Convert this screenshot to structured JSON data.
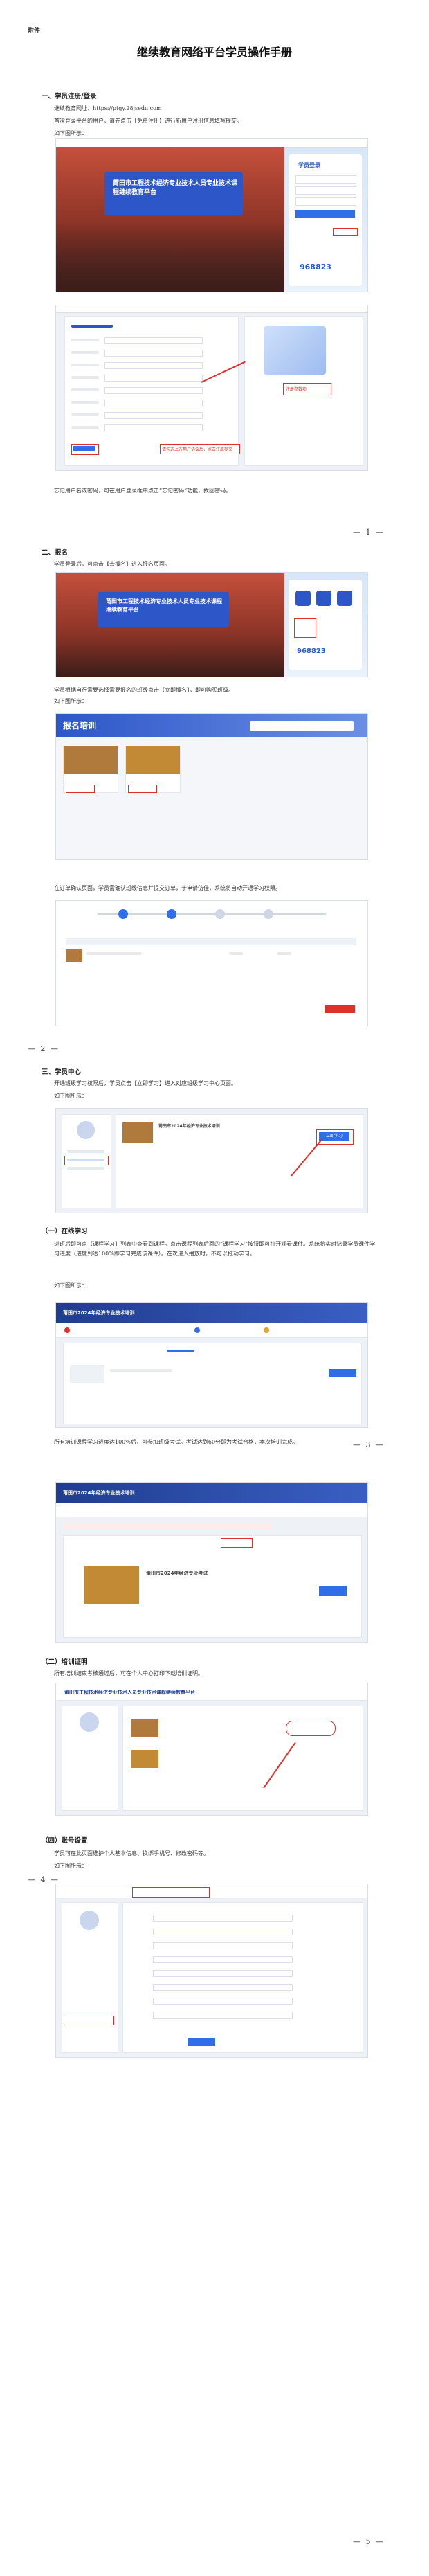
{
  "attachment": "附件",
  "title": "继续教育网络平台学员操作手册",
  "s1": {
    "heading": "一、学员注册/登录",
    "site": "继续教育网址：https://ptgy.28jsedu.com",
    "reg_text": "首次登录平台的用户，请先点击【免费注册】进行新用户注册信息填写提交。",
    "fig": "如下图所示：",
    "forgot": "忘记用户名或密码，可在用户登录框中点击“忘记密码”功能，找回密码。",
    "banner_title": "莆田市工程技术经济专业技术人员专业技术课程继续教育平台",
    "login_title": "学员登录",
    "phone": "968823",
    "reg_callout": "注册参数项",
    "agree_tip": "请勾选上方用户协议后，点击注册提交"
  },
  "page1": "— 1 —",
  "s2": {
    "heading": "二、报名",
    "text1": "学员登录后，可点击【去报名】进入报名页面。",
    "banner_title": "莆田市工程技术经济专业技术人员专业技术课程继续教育平台",
    "phone": "968823",
    "text2": "学员根据自行需要选择需要报名的班级点击【立即报名】，即可购买班级。",
    "fig": "如下图所示：",
    "banner_label": "报名培训",
    "text3": "在订单确认页面，学员需确认班级信息并提交订单，于申请仿佳，系统将自动开通学习权限。"
  },
  "page2": "— 2 —",
  "s3": {
    "heading": "三、学员中心",
    "text1": "开通班级学习权限后，学员点击【立即学习】进入对应班级学习中心页面。",
    "fig": "如下图所示：",
    "course_title": "莆田市2024年经济专业技术培训",
    "learn_btn": "立即学习",
    "sub1": "（一）在线学习",
    "text2": "进班后即可点【课程学习】列表中查看到课程。点击课程列表后面的“课程学习”按钮即可打开观看课件。系统将实时记录学员课件学习进度（进度到达100%即学习完成该课件）。在次进入播放时，不可以拖动学习。",
    "fig2": "如下图所示：",
    "banner2": "莆田市2024年经济专业技术培训",
    "text3": "所有培训课程学习进度达100%后，可参加班级考试。考试达到60分即为考试合格，本次培训完成。"
  },
  "page3": "— 3 —",
  "s4": {
    "banner3": "莆田市2024年经济专业技术培训",
    "exam_title": "莆田市2024年经济专业考试",
    "sub2": "（二）培训证明",
    "text1": "所有培训结束考核通过后，可在个人中心打印下载培训证明。",
    "banner_title": "莆田市工程技术经济专业技术人员专业技术课程继续教育平台",
    "sub3": "（四）账号设置",
    "text2": "学员可在此页面维护个人基本信息、换绑手机号、修改密码等。",
    "fig": "如下图所示："
  },
  "page4": "— 4 —",
  "page5": "— 5 —",
  "colors": {
    "brand": "#2d56c8",
    "header": "#1f3d8f",
    "highlight": "#e0302a",
    "button": "#2f6ee8"
  }
}
